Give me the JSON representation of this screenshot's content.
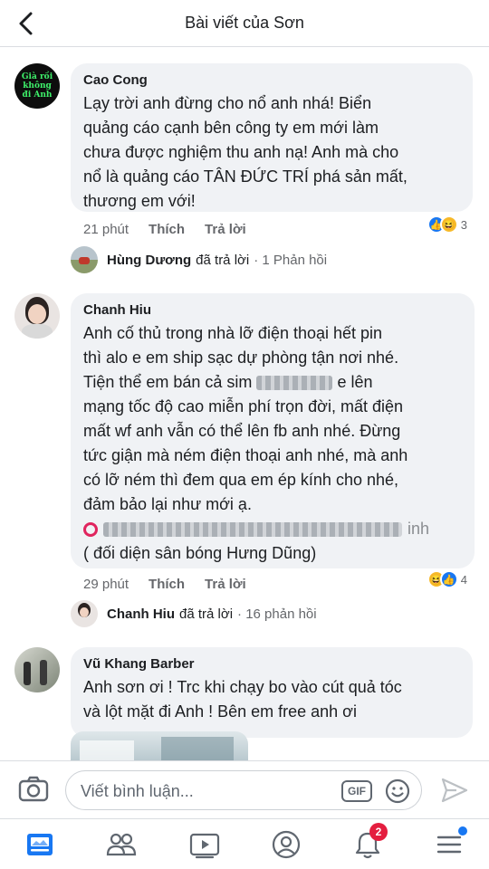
{
  "header": {
    "title": "Bài viết của Sơn"
  },
  "comments": [
    {
      "author": "Cao Cong",
      "avatar_text": "Già rồi không đi Anh",
      "lines": [
        "Lạy trời anh đừng cho nổ anh nhá! Biển",
        "quảng cáo cạnh bên công ty em mới làm",
        "chưa được nghiệm thu anh nạ!  Anh mà cho",
        "nổ là quảng cáo TÂN ĐỨC TRÍ phá sản mất,",
        "thương em với!"
      ],
      "time": "21 phút",
      "like": "Thích",
      "reply": "Trả lời",
      "reaction_count": "3",
      "reply_summary": {
        "name": "Hùng Dương",
        "action": "đã trả lời",
        "count": "· 1 Phản hồi"
      }
    },
    {
      "author": "Chanh Hiu",
      "lines": [
        "Anh cố thủ trong nhà lỡ điện thoại hết pin",
        "thì alo e em ship sạc dự phòng tận nơi nhé.",
        "Tiện thể em bán cả sim",
        "mạng tốc độ cao miễn phí trọn đời, mất điện",
        "mất wf anh vẫn có thể lên fb anh nhé. Đừng",
        "tức giận mà ném điện thoại anh nhé, mà anh",
        "có lỡ ném thì đem qua em ép kính cho nhé,",
        "đảm bảo lại như mới ạ."
      ],
      "line3_tail": "e lên",
      "address_tail": "inh",
      "address_line": "( đối diện sân bóng Hưng Dũng)",
      "time": "29 phút",
      "like": "Thích",
      "reply": "Trả lời",
      "reaction_count": "4",
      "reply_summary": {
        "name": "Chanh Hiu",
        "action": "đã trả lời",
        "count": "· 16 phản hồi"
      }
    },
    {
      "author": "Vũ Khang Barber",
      "lines": [
        "Anh sơn ơi ! Trc khi chạy bo vào cút quả tóc",
        "và lột mặt đi Anh ! Bên em free anh ơi"
      ]
    }
  ],
  "composer": {
    "placeholder": "Viết bình luận...",
    "gif_label": "GIF"
  },
  "tabbar": {
    "notifications_badge": "2"
  },
  "icons": [
    "back-arrow-icon",
    "camera-icon",
    "emoji-icon",
    "send-icon",
    "news-feed-icon",
    "friends-icon",
    "watch-icon",
    "profile-icon",
    "bell-icon",
    "menu-icon"
  ],
  "colors": {
    "accent": "#1877f2",
    "bubble": "#f0f2f5",
    "badge": "#e41e3f"
  }
}
